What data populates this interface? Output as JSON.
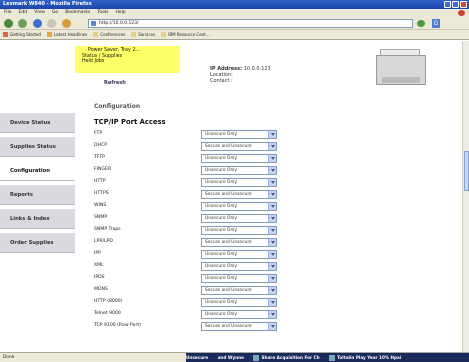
{
  "window": {
    "title": "Lexmark W840 - Mozilla Firefox"
  },
  "menu": [
    "File",
    "Edit",
    "View",
    "Go",
    "Bookmarks",
    "Tools",
    "Help"
  ],
  "nav": {
    "url": "http://10.0.0.123/"
  },
  "bookmarks": [
    "Getting Started",
    "Latest Headlines",
    "Conferences",
    "Services",
    "IBM Resource Cent..."
  ],
  "status_box": {
    "lines": [
      "Power Saver, Tray 2...",
      "Status / Supplies",
      "Held Jobs"
    ]
  },
  "refresh_label": "Refresh",
  "device_info": {
    "ip_label": "IP Address:",
    "ip_value": "10.0.0.123",
    "location_label": "Location:",
    "contact_label": "Contact :"
  },
  "sidebar": {
    "items": [
      "Device Status",
      "Supplies Status",
      "Configuration",
      "Reports",
      "Links & Index",
      "Order Supplies"
    ],
    "active": "Configuration"
  },
  "main": {
    "cut_heading": "Configuration",
    "section_title": "TCP/IP Port Access",
    "rows": [
      {
        "label": "FTP",
        "value": "Unsecure Only"
      },
      {
        "label": "DHCP",
        "value": "Secure and Unsecure"
      },
      {
        "label": "TFTP",
        "value": "Unsecure Only"
      },
      {
        "label": "FINGER",
        "value": "Unsecure Only"
      },
      {
        "label": "HTTP",
        "value": "Unsecure Only"
      },
      {
        "label": "HTTPS",
        "value": "Secure and Unsecure"
      },
      {
        "label": "WINS",
        "value": "Unsecure Only"
      },
      {
        "label": "SNMP",
        "value": "Unsecure Only"
      },
      {
        "label": "SNMP Traps",
        "value": "Unsecure Only"
      },
      {
        "label": "LPR/LPD",
        "value": "Secure and Unsecure"
      },
      {
        "label": "IPP",
        "value": "Unsecure Only"
      },
      {
        "label": "XML",
        "value": "Unsecure Only"
      },
      {
        "label": "IPDS",
        "value": "Unsecure Only"
      },
      {
        "label": "MDNS",
        "value": "Secure and Unsecure"
      },
      {
        "label": "HTTP (8000)",
        "value": "Unsecure Only"
      },
      {
        "label": "Telnet 9000",
        "value": "Unsecure Only"
      },
      {
        "label": "TCP 9100 (Raw Port)",
        "value": "Secure and Unsecure"
      }
    ]
  },
  "statusbar": {
    "status": "Done",
    "ticker": [
      "Unsecure",
      "and Wynne",
      "Share Acquisition For Ch",
      "Toltalin Play Year 10% Hpai"
    ]
  }
}
